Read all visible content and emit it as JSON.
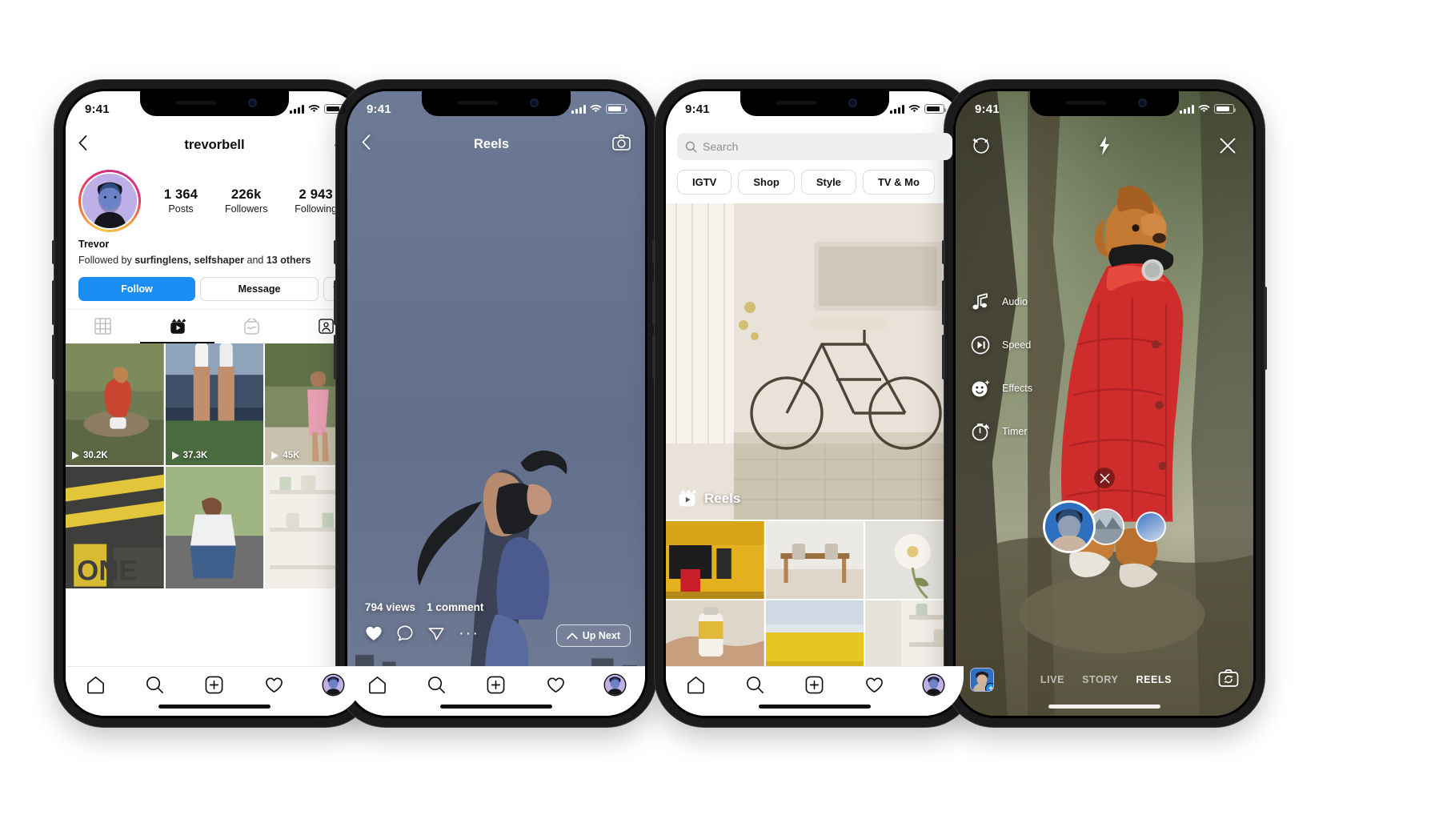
{
  "status_bar": {
    "time": "9:41"
  },
  "phone1_profile": {
    "header": {
      "back_icon": "chevron-left-icon",
      "title": "trevorbell",
      "more_icon": "ellipsis-icon"
    },
    "stats": [
      {
        "value": "1 364",
        "label": "Posts"
      },
      {
        "value": "226k",
        "label": "Followers"
      },
      {
        "value": "2 943",
        "label": "Following"
      }
    ],
    "bio": {
      "name": "Trevor",
      "followed_by_prefix": "Followed by ",
      "followed_by_names": "surfinglens, selfshaper",
      "followed_by_mid": " and ",
      "followed_by_others": "13 others"
    },
    "actions": {
      "follow_label": "Follow",
      "message_label": "Message",
      "caret_icon": "chevron-down-icon",
      "follow_color": "#1c8ef3"
    },
    "tabs": [
      {
        "name": "grid-tab",
        "icon": "grid-icon",
        "active": false
      },
      {
        "name": "reels-tab",
        "icon": "reels-icon",
        "active": true
      },
      {
        "name": "igtv-tab",
        "icon": "igtv-icon",
        "active": false
      },
      {
        "name": "tagged-tab",
        "icon": "tagged-person-icon",
        "active": false
      }
    ],
    "grid": [
      {
        "views": "30.2K",
        "alt": "dog in red vest on rock"
      },
      {
        "views": "37.3K",
        "alt": "legs with white sneakers"
      },
      {
        "views": "45K",
        "alt": "person with pink yoga mat"
      },
      {
        "views": "",
        "alt": "yellow road markings"
      },
      {
        "views": "",
        "alt": "girl sitting on curb"
      },
      {
        "views": "",
        "alt": "white shelves with plants"
      }
    ],
    "tabbar": [
      "home-icon",
      "search-icon",
      "plus-square-icon",
      "heart-icon",
      "profile-avatar"
    ]
  },
  "phone2_reels": {
    "header": {
      "back_icon": "chevron-left-icon",
      "title": "Reels",
      "camera_icon": "camera-icon"
    },
    "meta": {
      "views": "794 views",
      "comments": "1 comment"
    },
    "actions": [
      "heart-icon",
      "comment-icon",
      "share-icon",
      "ellipsis-icon"
    ],
    "up_next": {
      "label": "Up Next",
      "icon": "chevron-up-icon"
    },
    "tabbar": [
      "home-icon",
      "search-icon",
      "plus-square-icon",
      "heart-icon",
      "profile-avatar"
    ]
  },
  "phone3_explore": {
    "search": {
      "placeholder": "Search",
      "icon": "search-icon"
    },
    "pills": [
      "IGTV",
      "Shop",
      "Style",
      "TV & Mo"
    ],
    "hero": {
      "badge_label": "Reels",
      "badge_icon": "reels-icon",
      "alt": "bicycle in bright bathroom"
    },
    "grid": [
      {
        "alt": "red chair yellow wall",
        "multi": false
      },
      {
        "alt": "wooden table chairs",
        "multi": false
      },
      {
        "alt": "white flower",
        "multi": true
      },
      {
        "alt": "hand holding product bottle",
        "multi": false
      },
      {
        "alt": "yellow wall blue sky",
        "multi": false
      },
      {
        "alt": "white interior",
        "multi": false
      }
    ],
    "tabbar": [
      "home-icon",
      "search-icon",
      "plus-square-icon",
      "heart-icon",
      "profile-avatar"
    ]
  },
  "phone4_camera": {
    "top": {
      "settings_icon": "sparkle-settings-icon",
      "flash_icon": "flash-icon",
      "close_icon": "close-icon"
    },
    "tools": [
      {
        "icon": "music-note-icon",
        "label": "Audio"
      },
      {
        "icon": "speed-icon",
        "label": "Speed"
      },
      {
        "icon": "effects-smiley-icon",
        "label": "Effects"
      },
      {
        "icon": "timer-icon",
        "label": "Timer"
      }
    ],
    "dismiss_icon": "close-icon",
    "modes": [
      {
        "label": "LIVE",
        "active": false
      },
      {
        "label": "STORY",
        "active": false
      },
      {
        "label": "REELS",
        "active": true
      }
    ],
    "gallery_icon": "gallery-thumb",
    "flip_icon": "flip-camera-icon"
  }
}
